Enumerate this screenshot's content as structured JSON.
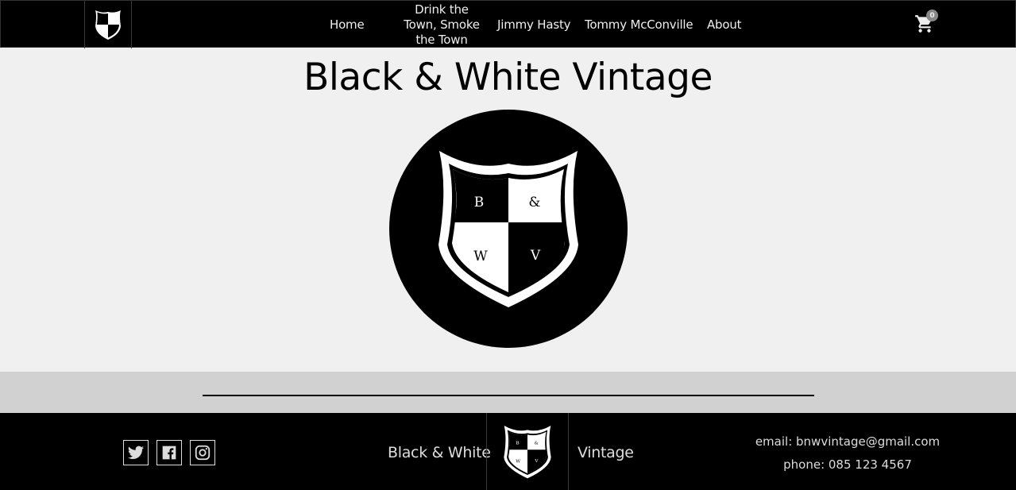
{
  "nav": {
    "items": [
      {
        "label": "Home"
      },
      {
        "label": "Drink the Town, Smoke the Town"
      },
      {
        "label": "Jimmy Hasty"
      },
      {
        "label": "Tommy McConville"
      },
      {
        "label": "About"
      }
    ],
    "cart_count": "0"
  },
  "hero": {
    "title": "Black & White Vintage"
  },
  "logo": {
    "letters": [
      "B",
      "&",
      "W",
      "V"
    ]
  },
  "footer": {
    "brand_left": "Black & White",
    "brand_right": "Vintage",
    "email": "email: bnwvintage@gmail.com",
    "phone": "phone: 085 123 4567",
    "social": [
      "twitter-icon",
      "facebook-icon",
      "instagram-icon"
    ]
  },
  "colors": {
    "nav_bg": "#000000",
    "page_bg": "#f0f0f0",
    "band_bg": "#d1d1d1",
    "footer_bg": "#000000"
  }
}
